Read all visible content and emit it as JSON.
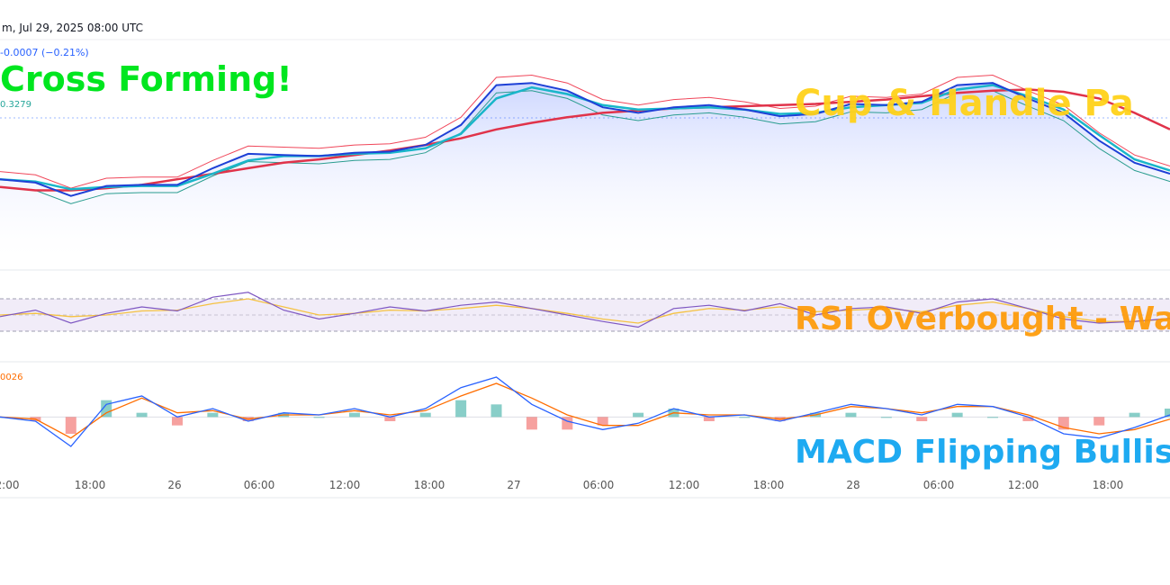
{
  "header": {
    "title": "m, Jul 29, 2025 08:00 UTC",
    "change": "-0.0007 (−0.21%)",
    "level_label": "0.3279",
    "macd_label": "0026"
  },
  "annotations": {
    "golden_cross": "Cross Forming!",
    "cup_handle": "Cup & Handle Pa",
    "rsi": "RSI Overbought - Wa",
    "macd": "MACD Flipping Bullis"
  },
  "colors": {
    "price": "#1e40d6",
    "ema_fast": "#19b6c9",
    "ma_slow": "#e0334a",
    "band_upper": "#f0475a",
    "band_lower": "#2a9d8f",
    "rsi": "#7e57c2",
    "rsi_ma": "#f5c242",
    "macd": "#2962ff",
    "signal": "#ff6d00",
    "hist_pos": "#26a69a",
    "hist_neg": "#ef5350"
  },
  "chart_data": {
    "type": "line",
    "x_tick_labels": [
      "2:00",
      "18:00",
      "26",
      "06:00",
      "12:00",
      "18:00",
      "27",
      "06:00",
      "12:00",
      "18:00",
      "28",
      "06:00",
      "12:00",
      "18:00"
    ],
    "price_panel": {
      "series": [
        {
          "name": "",
          "values": [
            0.85,
            0.82,
            0.7,
            0.79,
            0.8,
            0.8,
            0.95,
            1.08,
            1.07,
            1.06,
            1.09,
            1.1,
            1.16,
            1.34,
            1.7,
            1.72,
            1.65,
            1.5,
            1.45,
            1.5,
            1.52,
            1.48,
            1.42,
            1.44,
            1.53,
            1.52,
            1.55,
            1.7,
            1.72,
            1.58,
            1.45,
            1.2,
            1.0,
            0.9
          ]
        },
        {
          "name": "",
          "values": [
            0.85,
            0.83,
            0.76,
            0.78,
            0.79,
            0.79,
            0.9,
            1.02,
            1.06,
            1.06,
            1.08,
            1.09,
            1.13,
            1.26,
            1.58,
            1.68,
            1.62,
            1.52,
            1.48,
            1.49,
            1.5,
            1.48,
            1.44,
            1.45,
            1.5,
            1.52,
            1.54,
            1.66,
            1.7,
            1.6,
            1.48,
            1.25,
            1.03,
            0.93
          ]
        },
        {
          "name": "",
          "values": [
            0.78,
            0.75,
            0.75,
            0.77,
            0.8,
            0.85,
            0.9,
            0.95,
            1.0,
            1.03,
            1.07,
            1.11,
            1.16,
            1.22,
            1.3,
            1.36,
            1.41,
            1.45,
            1.47,
            1.49,
            1.5,
            1.51,
            1.52,
            1.53,
            1.55,
            1.57,
            1.6,
            1.63,
            1.65,
            1.66,
            1.64,
            1.58,
            1.45,
            1.3
          ]
        }
      ]
    },
    "rsi_panel": {
      "overbought": 70,
      "oversold": 30,
      "rsi": [
        48,
        56,
        40,
        52,
        60,
        55,
        72,
        78,
        56,
        45,
        52,
        60,
        55,
        62,
        66,
        58,
        50,
        42,
        35,
        58,
        62,
        55,
        64,
        50,
        58,
        60,
        52,
        66,
        70,
        58,
        45,
        40,
        42,
        46
      ],
      "rsi_ma": [
        50,
        52,
        48,
        50,
        55,
        56,
        64,
        70,
        60,
        50,
        52,
        56,
        55,
        58,
        62,
        58,
        52,
        45,
        40,
        52,
        58,
        56,
        60,
        54,
        56,
        58,
        54,
        62,
        66,
        58,
        48,
        42,
        42,
        45
      ]
    },
    "macd_panel": {
      "macd": [
        0.0,
        -0.2,
        -1.4,
        0.6,
        1.0,
        0.0,
        0.4,
        -0.2,
        0.2,
        0.1,
        0.4,
        0.0,
        0.4,
        1.4,
        1.9,
        0.6,
        -0.2,
        -0.6,
        -0.3,
        0.4,
        0.0,
        0.1,
        -0.2,
        0.2,
        0.6,
        0.4,
        0.1,
        0.6,
        0.5,
        0.0,
        -0.8,
        -1.0,
        -0.5,
        0.1
      ],
      "signal": [
        0.0,
        -0.1,
        -1.0,
        0.2,
        0.9,
        0.2,
        0.3,
        -0.1,
        0.1,
        0.1,
        0.3,
        0.1,
        0.3,
        1.0,
        1.6,
        0.9,
        0.1,
        -0.4,
        -0.4,
        0.2,
        0.1,
        0.1,
        -0.1,
        0.1,
        0.5,
        0.4,
        0.2,
        0.5,
        0.5,
        0.1,
        -0.5,
        -0.8,
        -0.6,
        -0.1
      ]
    }
  }
}
